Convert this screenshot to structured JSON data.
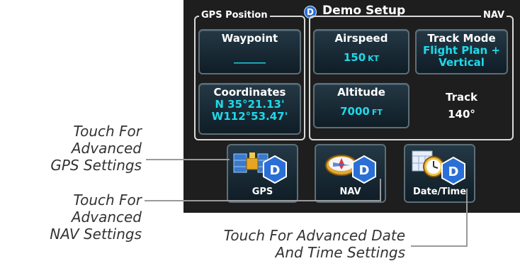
{
  "header": {
    "title": "Demo Setup",
    "badge": "D"
  },
  "gps_group": {
    "label": "GPS Position",
    "waypoint": {
      "label": "Waypoint",
      "value": "______"
    },
    "coordinates": {
      "label": "Coordinates",
      "lat": "N 35°21.13'",
      "lon": "W112°53.47'"
    }
  },
  "nav_group": {
    "label": "NAV",
    "airspeed": {
      "label": "Airspeed",
      "value": "150",
      "unit": "KT"
    },
    "track_mode": {
      "label": "Track Mode",
      "value_line1": "Flight Plan +",
      "value_line2": "Vertical"
    },
    "altitude": {
      "label": "Altitude",
      "value": "7000",
      "unit": "FT"
    },
    "track": {
      "label": "Track",
      "value": "140°"
    }
  },
  "apps": [
    {
      "label": "GPS",
      "badge": "D"
    },
    {
      "label": "NAV",
      "badge": "D"
    },
    {
      "label": "Date/Time",
      "badge": "D"
    }
  ],
  "callouts": {
    "gps": {
      "line1": "Touch For Advanced",
      "line2": "GPS Settings"
    },
    "nav": {
      "line1": "Touch For Advanced",
      "line2": "NAV Settings"
    },
    "datetime": {
      "line1": "Touch For Advanced Date",
      "line2": "And Time Settings"
    }
  },
  "colors": {
    "screen_bg": "#1e1e1e",
    "value_cyan": "#1fd9e8",
    "badge_blue": "#2a6fd6"
  }
}
